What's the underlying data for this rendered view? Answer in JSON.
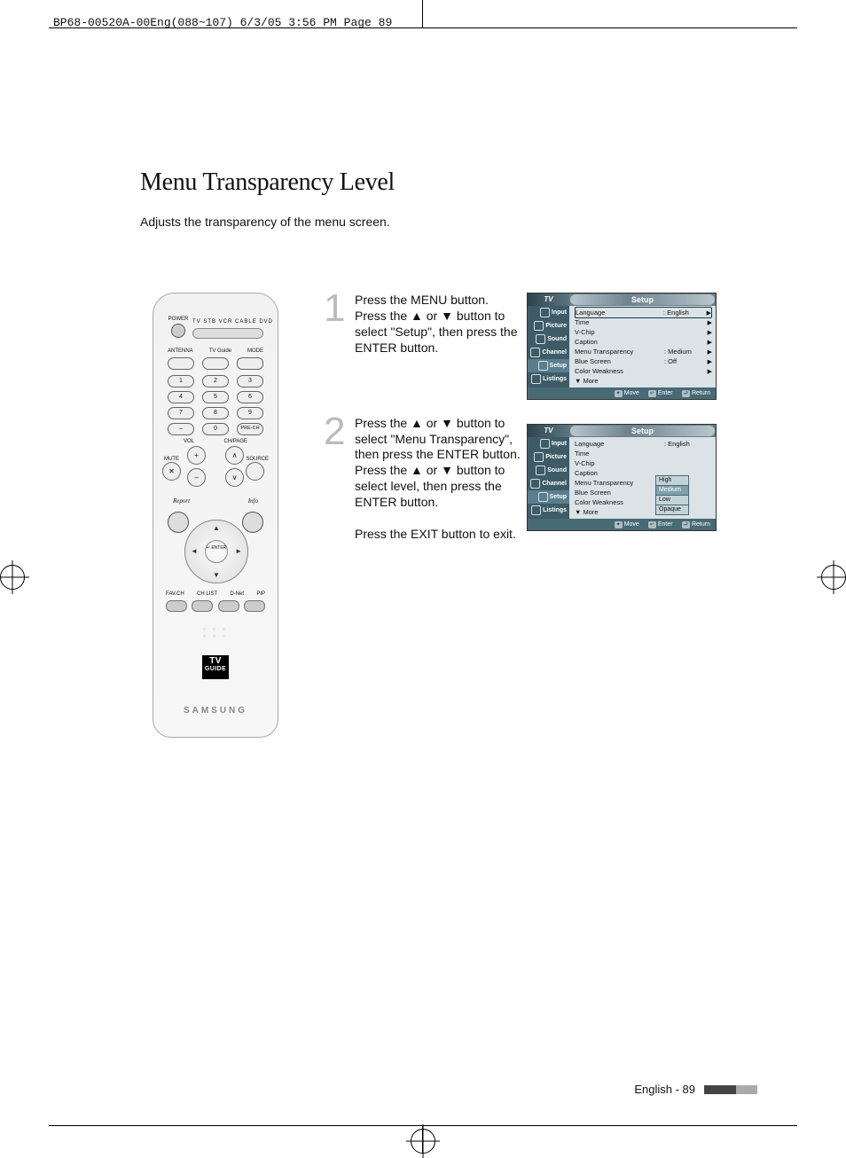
{
  "slug": "BP68-00520A-00Eng(088~107)  6/3/05  3:56 PM  Page 89",
  "title": "Menu Transparency Level",
  "intro": "Adjusts the transparency of the menu screen.",
  "steps": {
    "n1": "1",
    "s1": "Press the MENU button. Press the ▲ or ▼ button to select \"Setup\", then press the ENTER button.",
    "n2": "2",
    "s2": "Press the ▲ or ▼ button to select \"Menu Transparency\", then press the ENTER button. Press the ▲ or ▼ button to select level, then press the ENTER button.",
    "exit": "Press the EXIT button to exit."
  },
  "remote": {
    "power": "POWER",
    "modes": "TV  STB  VCR  CABLE  DVD",
    "row_labels": [
      "ANTENNA",
      "TV Guide",
      "MODE"
    ],
    "numpad": [
      [
        "1",
        "2",
        "3"
      ],
      [
        "4",
        "5",
        "6"
      ],
      [
        "7",
        "8",
        "9"
      ],
      [
        "–",
        "0",
        "PRE-CH"
      ]
    ],
    "vol": "VOL",
    "ch": "CH/PAGE",
    "mute": "MUTE",
    "source": "SOURCE",
    "mute_sym": "✕",
    "report": "Report",
    "info": "Info",
    "enter": "↵\nENTER",
    "bottom_labels": [
      "FAV.CH",
      "CH LIST",
      "D-Net",
      "PIP"
    ],
    "tvguide_top": "TV",
    "tvguide_bot": "GUIDE",
    "brand": "SAMSUNG"
  },
  "osd": {
    "tv": "TV",
    "title": "Setup",
    "side": [
      "Input",
      "Picture",
      "Sound",
      "Channel",
      "Setup",
      "Listings"
    ],
    "rows1": [
      {
        "k": "Language",
        "v": ": English",
        "ar": "▶",
        "box": true
      },
      {
        "k": "Time",
        "v": "",
        "ar": "▶"
      },
      {
        "k": "V-Chip",
        "v": "",
        "ar": "▶"
      },
      {
        "k": "Caption",
        "v": "",
        "ar": "▶"
      },
      {
        "k": "Menu Transparency",
        "v": ": Medium",
        "ar": "▶"
      },
      {
        "k": "Blue Screen",
        "v": ": Off",
        "ar": "▶"
      },
      {
        "k": "Color Weakness",
        "v": "",
        "ar": "▶"
      },
      {
        "k": "▼ More",
        "v": "",
        "ar": ""
      }
    ],
    "rows2": [
      {
        "k": "Language",
        "v": ": English",
        "ar": ""
      },
      {
        "k": "Time",
        "v": "",
        "ar": ""
      },
      {
        "k": "V-Chip",
        "v": "",
        "ar": ""
      },
      {
        "k": "Caption",
        "v": "",
        "ar": ""
      },
      {
        "k": "Menu Transparency",
        "v": "",
        "ar": ""
      },
      {
        "k": "Blue Screen",
        "v": "",
        "ar": ""
      },
      {
        "k": "Color Weakness",
        "v": "",
        "ar": ""
      },
      {
        "k": "▼ More",
        "v": "",
        "ar": ""
      }
    ],
    "options": [
      "High",
      "Medium",
      "Low",
      "Opaque"
    ],
    "selected_option": 1,
    "foot": {
      "move": "Move",
      "enter": "Enter",
      "return": "Return",
      "sym_move": "✦",
      "sym_enter": "↵",
      "sym_return": "⮐"
    }
  },
  "footer": {
    "label": "English - 89"
  }
}
